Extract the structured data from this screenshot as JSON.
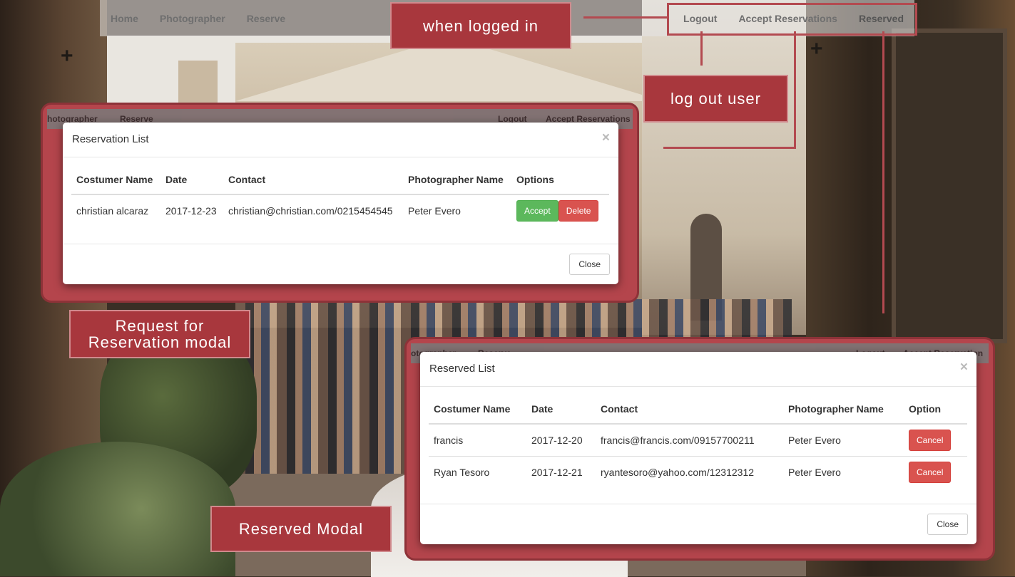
{
  "navbar": {
    "left": [
      "Home",
      "Photographer",
      "Reserve"
    ],
    "right": [
      "Logout",
      "Accept Reservations",
      "Reserved"
    ]
  },
  "callouts": {
    "logged_in": "when logged in",
    "logout": "log out user",
    "request_modal": "Request for Reservation modal",
    "reserved_modal": "Reserved Modal"
  },
  "ghost_nav_1": {
    "left": [
      "hotographer",
      "Reserve"
    ],
    "right": [
      "Logout",
      "Accept Reservations"
    ]
  },
  "ghost_nav_2": {
    "left": [
      "otographer",
      "Reserve"
    ],
    "right": [
      "Logout",
      "Accept Reservation"
    ]
  },
  "reservation_modal": {
    "title": "Reservation List",
    "close_x": "×",
    "headers": [
      "Costumer Name",
      "Date",
      "Contact",
      "Photographer Name",
      "Options"
    ],
    "rows": [
      {
        "customer": "christian alcaraz",
        "date": "2017-12-23",
        "contact": "christian@christian.com/0215454545",
        "photographer": "Peter Evero",
        "accept": "Accept",
        "delete": "Delete"
      }
    ],
    "close_label": "Close"
  },
  "reserved_modal": {
    "title": "Reserved List",
    "close_x": "×",
    "headers": [
      "Costumer Name",
      "Date",
      "Contact",
      "Photographer Name",
      "Option"
    ],
    "rows": [
      {
        "customer": "francis",
        "date": "2017-12-20",
        "contact": "francis@francis.com/09157700211",
        "photographer": "Peter Evero",
        "cancel": "Cancel"
      },
      {
        "customer": "Ryan Tesoro",
        "date": "2017-12-21",
        "contact": "ryantesoro@yahoo.com/12312312",
        "photographer": "Peter Evero",
        "cancel": "Cancel"
      }
    ],
    "close_label": "Close"
  },
  "colors": {
    "annotation": "#a8373d",
    "success": "#5cb85c",
    "danger": "#d9534f"
  }
}
